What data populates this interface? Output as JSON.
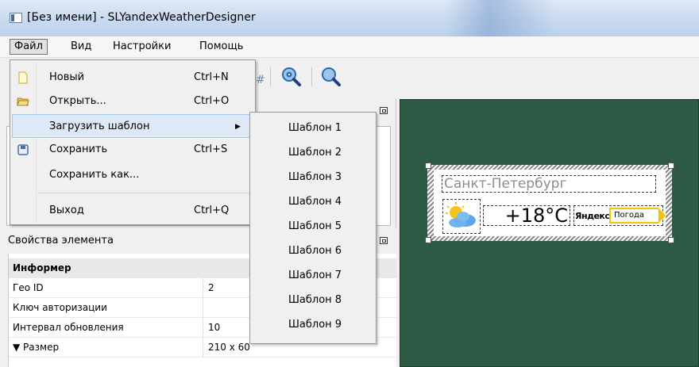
{
  "window": {
    "title": "[Без имени] - SLYandexWeatherDesigner"
  },
  "menubar": {
    "items": [
      "Файл",
      "Вид",
      "Настройки",
      "Помощь"
    ]
  },
  "file_menu": {
    "items": [
      {
        "label": "Новый",
        "shortcut": "Ctrl+N",
        "icon": "new-file-icon"
      },
      {
        "label": "Открыть...",
        "shortcut": "Ctrl+O",
        "icon": "open-folder-icon"
      },
      {
        "label": "Загрузить шаблон",
        "shortcut": "",
        "icon": ""
      },
      {
        "label": "Сохранить",
        "shortcut": "Ctrl+S",
        "icon": "save-icon"
      },
      {
        "label": "Сохранить как...",
        "shortcut": "",
        "icon": ""
      },
      {
        "label": "Выход",
        "shortcut": "Ctrl+Q",
        "icon": ""
      }
    ]
  },
  "template_submenu": {
    "items": [
      "Шаблон 1",
      "Шаблон 2",
      "Шаблон 3",
      "Шаблон 4",
      "Шаблон 5",
      "Шаблон 6",
      "Шаблон 7",
      "Шаблон 8",
      "Шаблон 9"
    ]
  },
  "properties": {
    "header": "Свойства элемента",
    "group": "Информер",
    "rows": [
      {
        "key": "Гео ID",
        "value": "2"
      },
      {
        "key": "Ключ авторизации",
        "value": ""
      },
      {
        "key": "Интервал обновления",
        "value": "10"
      },
      {
        "key": "▼ Размер",
        "value": "210 x 60"
      }
    ]
  },
  "preview": {
    "city": "Санкт-Петербург",
    "temperature": "+18°C",
    "brand": "Яндекс",
    "badge": "Погода"
  },
  "colors": {
    "canvas": "#2c5a45",
    "badge_accent": "#f5c400",
    "menu_highlight": "#dde9f7"
  }
}
